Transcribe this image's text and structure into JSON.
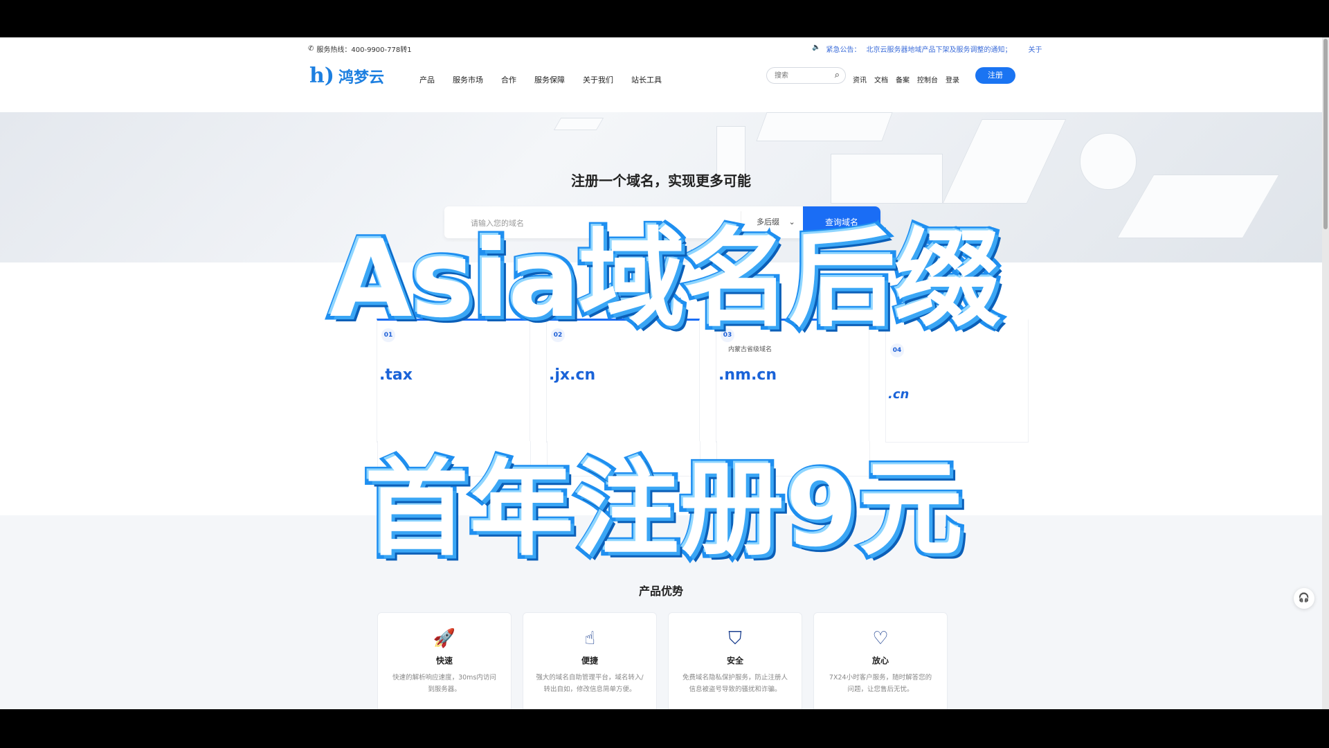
{
  "topbar": {
    "hotline_label": "服务热线：400-9900-778转1",
    "notice_label": "紧急公告：",
    "notice_text": "北京云服务器地域产品下架及服务调整的通知；",
    "notice_more": "关于"
  },
  "header": {
    "logo_text": "鸿梦云",
    "nav": [
      "产品",
      "服务市场",
      "合作",
      "服务保障",
      "关于我们",
      "站长工具"
    ],
    "search_placeholder": "搜索",
    "links": [
      "资讯",
      "文档",
      "备案",
      "控制台",
      "登录"
    ],
    "register_label": "注册"
  },
  "hero": {
    "title": "注册一个域名，实现更多可能",
    "input_placeholder": "请输入您的域名",
    "suffix_label": "多后缀",
    "button_label": "查询域名"
  },
  "cards": [
    {
      "no": "01",
      "sub": "",
      "name": ".tax"
    },
    {
      "no": "02",
      "sub": "",
      "name": ".jx.cn"
    },
    {
      "no": "03",
      "sub": "内蒙古省级域名",
      "name": ".nm.cn"
    },
    {
      "no": "04",
      "sub": "",
      "name": ".cn"
    }
  ],
  "advantages": {
    "title": "产品优势",
    "items": [
      {
        "icon": "rocket-icon",
        "title": "快速",
        "desc": "快速的解析响应速度，30ms内访问到服务器。"
      },
      {
        "icon": "pointer-icon",
        "title": "便捷",
        "desc": "强大的域名自助管理平台，域名转入/转出自如，修改信息简单方便。"
      },
      {
        "icon": "shield-icon",
        "title": "安全",
        "desc": "免费域名隐私保护服务，防止注册人信息被盗号导致的骚扰和诈骗。"
      },
      {
        "icon": "heart-icon",
        "title": "放心",
        "desc": "7X24小时客户服务，随时解答您的问题，让您售后无忧。"
      }
    ]
  },
  "overlay": {
    "line1": "Asia域名后缀",
    "line2": "首年注册9元"
  }
}
